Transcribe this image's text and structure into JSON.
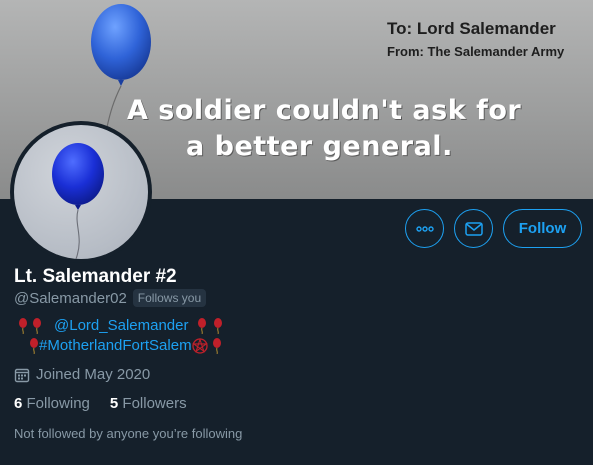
{
  "banner": {
    "to_line": "To: Lord Salemander",
    "from_line": "From: The Salemander Army",
    "slogan_line1": "A soldier couldn't ask for",
    "slogan_line2": "a better general."
  },
  "actions": {
    "more_icon": "more-horizontal-icon",
    "message_icon": "envelope-icon",
    "follow_label": "Follow"
  },
  "profile": {
    "display_name": "Lt. Salemander #2",
    "handle": "@Salemander02",
    "follows_you": "Follows you",
    "bio_mention": "@Lord_Salemander",
    "bio_hashtag": "#MotherlandFortSalem",
    "joined": "Joined May 2020",
    "following_count": "6",
    "following_label": "Following",
    "followers_count": "5",
    "followers_label": "Followers",
    "not_followed": "Not followed by anyone you’re following"
  },
  "colors": {
    "background": "#15202b",
    "accent": "#1da1f2",
    "muted": "#8899a6",
    "balloon": "#1f4fcf",
    "emoji_balloon": "#c0202a"
  }
}
